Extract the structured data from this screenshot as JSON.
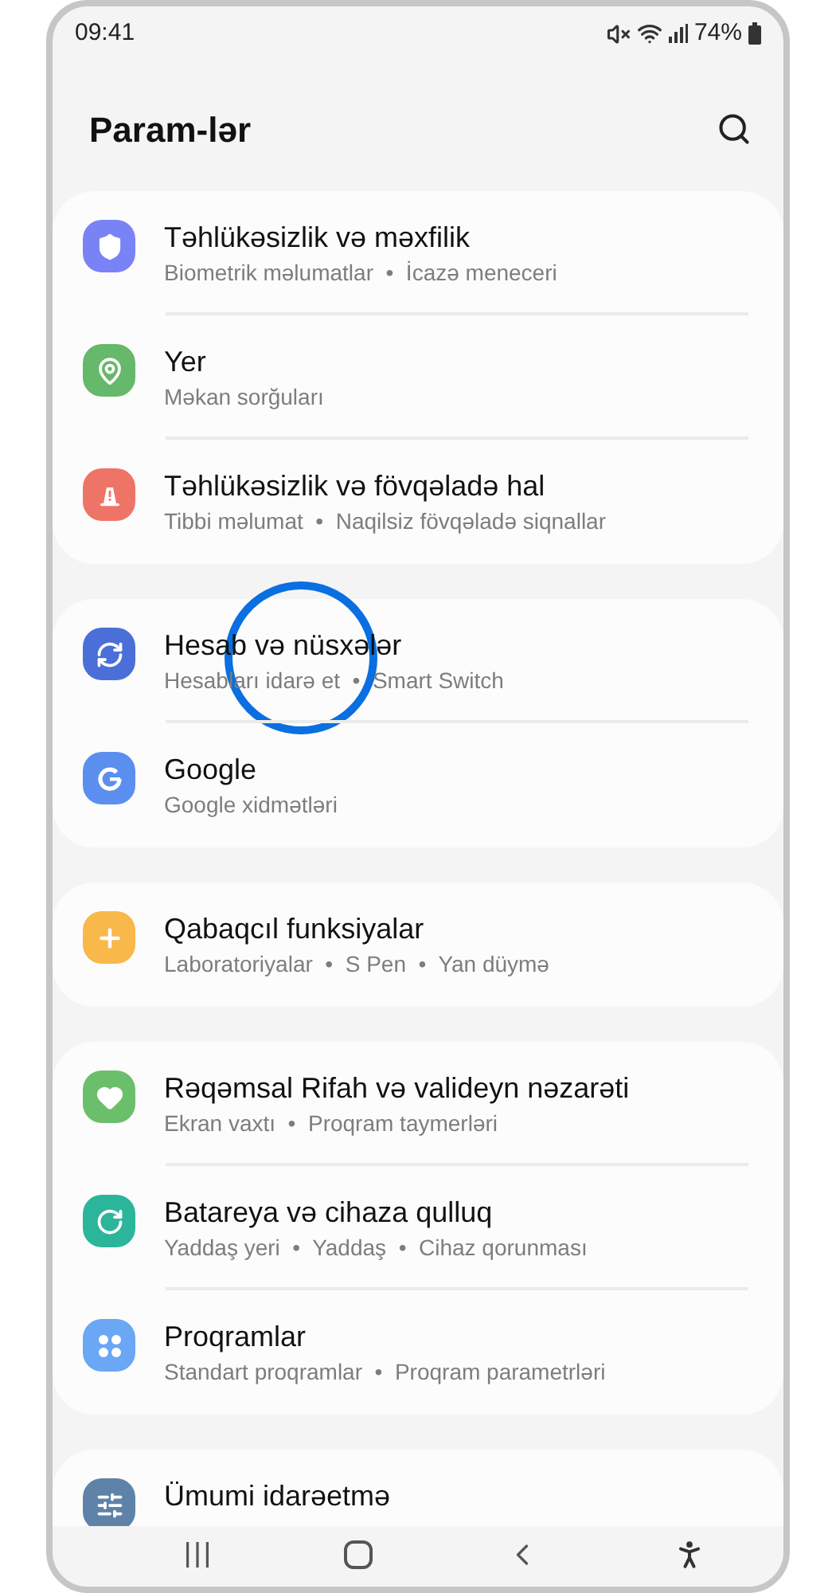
{
  "status_bar": {
    "time": "09:41",
    "battery": "74%"
  },
  "header": {
    "title": "Param-lər"
  },
  "groups": [
    {
      "items": [
        {
          "kind": "security",
          "color": "#7a83f5",
          "title": "Təhlükəsizlik və məxfilik",
          "subtitle": "Biometrik məlumatlar  •  İcazə meneceri",
          "highlighted": false
        },
        {
          "kind": "location",
          "color": "#66b86a",
          "title": "Yer",
          "subtitle": "Məkan sorğuları",
          "highlighted": false
        },
        {
          "kind": "emergency",
          "color": "#ef7468",
          "title": "Təhlükəsizlik və fövqəladə hal",
          "subtitle": "Tibbi məlumat  •  Naqilsiz fövqəladə siqnallar",
          "highlighted": false
        }
      ]
    },
    {
      "items": [
        {
          "kind": "accounts",
          "color": "#4a6fd8",
          "title": "Hesab və nüsxələr",
          "subtitle": "Hesabları idarə et  •  Smart Switch",
          "highlighted": true
        },
        {
          "kind": "google",
          "color": "#5b8fef",
          "title": "Google",
          "subtitle": "Google xidmətləri",
          "highlighted": false
        }
      ]
    },
    {
      "items": [
        {
          "kind": "advanced",
          "color": "#f8b84a",
          "title": "Qabaqcıl funksiyalar",
          "subtitle": "Laboratoriyalar  •  S Pen  •  Yan düymə",
          "highlighted": false
        }
      ]
    },
    {
      "items": [
        {
          "kind": "wellbeing",
          "color": "#6cbf6a",
          "title": "Rəqəmsal Rifah və valideyn nəzarəti",
          "subtitle": "Ekran vaxtı  •  Proqram taymerləri",
          "highlighted": false
        },
        {
          "kind": "care",
          "color": "#2bb59a",
          "title": "Batareya və cihaza qulluq",
          "subtitle": "Yaddaş yeri  •  Yaddaş  •  Cihaz qorunması",
          "highlighted": false
        },
        {
          "kind": "apps",
          "color": "#6aa7f4",
          "title": "Proqramlar",
          "subtitle": "Standart proqramlar  •  Proqram parametrləri",
          "highlighted": false
        }
      ]
    },
    {
      "items": [
        {
          "kind": "general",
          "color": "#5f83a8",
          "title": "Ümumi idarəetmə",
          "highlighted": false
        }
      ]
    }
  ]
}
